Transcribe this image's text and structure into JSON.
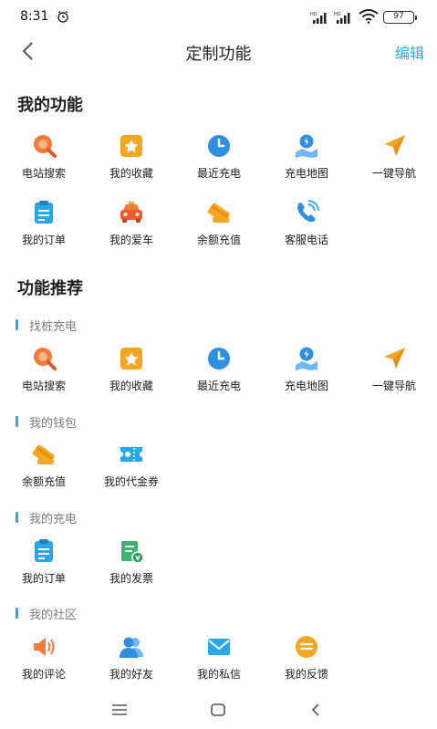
{
  "status_bar": {
    "time": "8:31",
    "battery": "97"
  },
  "header": {
    "title": "定制功能",
    "edit_label": "编辑"
  },
  "my_functions": {
    "title": "我的功能",
    "items": [
      {
        "label": "电站搜索",
        "icon": "station-search-icon"
      },
      {
        "label": "我的收藏",
        "icon": "favorites-icon"
      },
      {
        "label": "最近充电",
        "icon": "clock-icon"
      },
      {
        "label": "充电地图",
        "icon": "map-icon"
      },
      {
        "label": "一键导航",
        "icon": "navigation-icon"
      },
      {
        "label": "我的订单",
        "icon": "order-icon"
      },
      {
        "label": "我的爱车",
        "icon": "car-icon"
      },
      {
        "label": "余额充值",
        "icon": "recharge-icon"
      },
      {
        "label": "客服电话",
        "icon": "phone-icon"
      }
    ]
  },
  "recommend": {
    "title": "功能推荐",
    "groups": [
      {
        "title": "找桩充电",
        "items": [
          {
            "label": "电站搜索",
            "icon": "station-search-icon"
          },
          {
            "label": "我的收藏",
            "icon": "favorites-icon"
          },
          {
            "label": "最近充电",
            "icon": "clock-icon"
          },
          {
            "label": "充电地图",
            "icon": "map-icon"
          },
          {
            "label": "一键导航",
            "icon": "navigation-icon"
          }
        ]
      },
      {
        "title": "我的钱包",
        "items": [
          {
            "label": "余额充值",
            "icon": "recharge-icon"
          },
          {
            "label": "我的代金券",
            "icon": "voucher-icon"
          }
        ]
      },
      {
        "title": "我的充电",
        "items": [
          {
            "label": "我的订单",
            "icon": "order-icon"
          },
          {
            "label": "我的发票",
            "icon": "invoice-icon"
          }
        ]
      },
      {
        "title": "我的社区",
        "items": [
          {
            "label": "我的评论",
            "icon": "comment-icon"
          },
          {
            "label": "我的好友",
            "icon": "friends-icon"
          },
          {
            "label": "我的私信",
            "icon": "message-icon"
          },
          {
            "label": "我的反馈",
            "icon": "feedback-icon"
          }
        ]
      }
    ]
  },
  "colors": {
    "accent": "#2aa7e6",
    "orange": "#f47a3a",
    "yellow": "#f5a623",
    "blue": "#2f8fe0"
  }
}
